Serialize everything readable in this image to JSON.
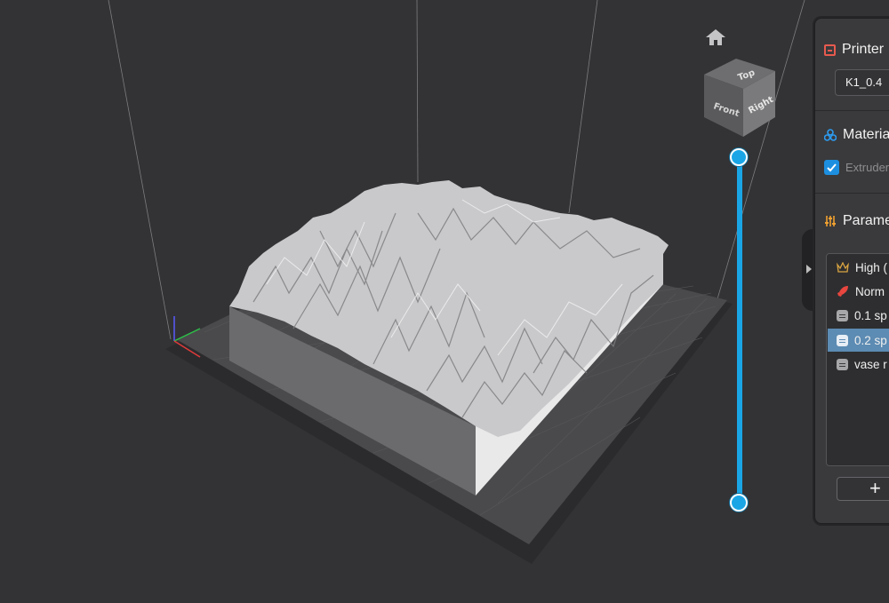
{
  "app": {
    "name": "3D slicer viewport"
  },
  "viewcube": {
    "top_label": "Top",
    "front_label": "Front",
    "right_label": "Right"
  },
  "panel": {
    "printer": {
      "title": "Printer",
      "selected": "K1_0.4"
    },
    "material": {
      "title": "Materia",
      "extruder_label": "Extruder",
      "extruder_checked": true
    },
    "parameters": {
      "title": "Parame",
      "presets": [
        {
          "label": "High (",
          "icon": "crown-icon",
          "selected": false
        },
        {
          "label": "Norm",
          "icon": "rocket-icon",
          "selected": false
        },
        {
          "label": "0.1 sp",
          "icon": "document-icon",
          "selected": false
        },
        {
          "label": "0.2 sp",
          "icon": "document-icon",
          "selected": true
        },
        {
          "label": "vase r",
          "icon": "document-icon",
          "selected": false
        }
      ],
      "add_label": "+"
    }
  },
  "colors": {
    "accent": "#1aa6e6",
    "background": "#333335",
    "panel": "#3a3a3c",
    "selected_row": "#5c8bb3",
    "printer_icon": "#e85a4f",
    "material_icon": "#2d9cf0",
    "parameters_icon": "#f0a030"
  }
}
